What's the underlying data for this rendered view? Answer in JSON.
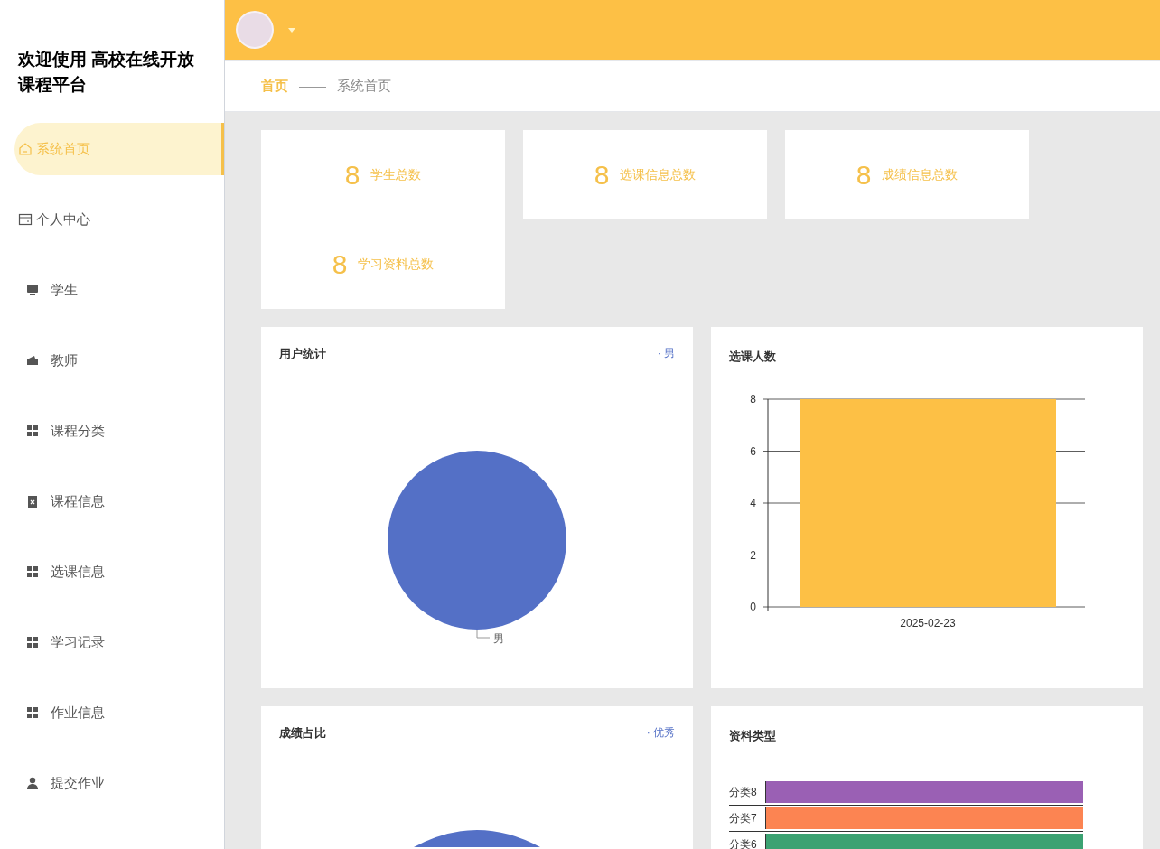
{
  "sidebar": {
    "title": "欢迎使用 高校在线开放课程平台",
    "items": [
      {
        "label": "系统首页",
        "kind": "home",
        "selected": true
      },
      {
        "label": "个人中心",
        "kind": "wallet",
        "selected": false
      },
      {
        "label": "学生",
        "kind": "monitor",
        "selected": false
      },
      {
        "label": "教师",
        "kind": "purse",
        "selected": false
      },
      {
        "label": "课程分类",
        "kind": "grid",
        "selected": false
      },
      {
        "label": "课程信息",
        "kind": "clipboard",
        "selected": false
      },
      {
        "label": "选课信息",
        "kind": "grid",
        "selected": false
      },
      {
        "label": "学习记录",
        "kind": "grid",
        "selected": false
      },
      {
        "label": "作业信息",
        "kind": "grid",
        "selected": false
      },
      {
        "label": "提交作业",
        "kind": "user",
        "selected": false
      }
    ]
  },
  "breadcrumb": {
    "home": "首页",
    "separator": "——",
    "current": "系统首页"
  },
  "stats": [
    {
      "value": "8",
      "label": "学生总数"
    },
    {
      "value": "8",
      "label": "选课信息总数"
    },
    {
      "value": "8",
      "label": "成绩信息总数"
    },
    {
      "value": "8",
      "label": "学习资料总数"
    }
  ],
  "user_stats": {
    "title": "用户统计",
    "legend": "· 男",
    "slice_label": "男"
  },
  "enrollment": {
    "title": "选课人数",
    "chart_data": {
      "type": "bar",
      "categories": [
        "2025-02-23"
      ],
      "series": [
        {
          "color": "#fdc045",
          "values": [
            8
          ]
        }
      ],
      "ylim": [
        0,
        8
      ],
      "yticks": [
        0,
        2,
        4,
        6,
        8
      ],
      "grid": true
    }
  },
  "grades": {
    "title": "成绩占比",
    "legend": "· 优秀"
  },
  "material_types": {
    "title": "资料类型",
    "bars": [
      {
        "label": "分类8",
        "color": "#9a60b4"
      },
      {
        "label": "分类7",
        "color": "#fc8452"
      },
      {
        "label": "分类6",
        "color": "#3ba272"
      }
    ]
  }
}
